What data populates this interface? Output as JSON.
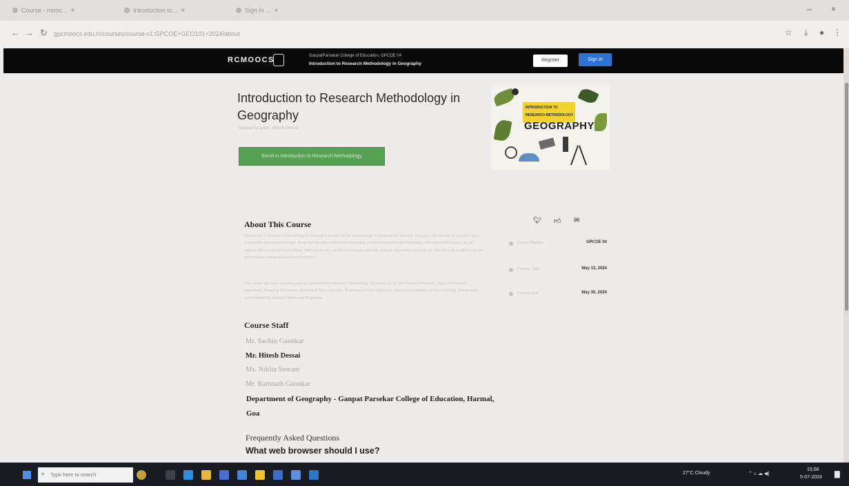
{
  "browser": {
    "tabs": [
      {
        "label": "Course - mooc..."
      },
      {
        "label": "Introduction to..."
      },
      {
        "label": "Sign in ..."
      }
    ],
    "url": "gpcmoocs.edu.in/courses/course-v1:GPCOE+GEO101+2024/about",
    "window_controls": {
      "minimize": "–",
      "close": "×"
    },
    "nav": {
      "back": "←",
      "forward": "→",
      "reload": "↻"
    }
  },
  "site": {
    "logo": "RCMOOCS",
    "course_code": "GanpatParsekar College of Education, GPCOE 04",
    "course_name": "Introduction to Research Methodology in Geography",
    "register_label": "Register",
    "signin_label": "Sign in"
  },
  "course": {
    "title": "Introduction to Research Methodology in Geography",
    "org": "GanpatParsekar · Hitesh Dessai",
    "enroll_label": "Enroll in Introduction to Research Methodology",
    "cover": {
      "line1": "INTRODUCTION TO",
      "line2": "RESEARCH METHODOLOGY",
      "word": "GEOGRAPHY"
    }
  },
  "about": {
    "title": "About This Course",
    "paragraph1": "Introduction to Research Methodology in Geography focuses on the methodology of geographical research. It explains the concept of research, types of research and research design, along with the steps involved in formulating a research problem and hypothesis. Throughout this course, we will explore different research paradigms, field techniques, sampling techniques and data analysis approaches to equip you with the tools needed to design and execute a geographical research project.",
    "paragraph2": "This course will cover concepts such as Introduction to Research Methodology, Research Design and Research Problem, Types of Research, Hypothesis, Sampling Techniques, Methods of Data Collection, Techniques of Data Collection, Steps and Guidelines of Report Writing, Bibliography and Referencing, Abstract Writing and Plagiarism."
  },
  "staff": {
    "title": "Course Staff",
    "members": [
      "Mr. Sachin Gaonkar",
      "Mr. Hitesh Dessai",
      "Ms. Nikita Sawant",
      "Mr. Ramnath Gaonkar"
    ],
    "department": "Department of Geography - Ganpat Parsekar College of Education, Harmal, Goa"
  },
  "faq": {
    "title": "Frequently Asked Questions",
    "first_question": "What web browser should I use?"
  },
  "sidebar": {
    "social": [
      "twitter-icon",
      "like-icon",
      "email-icon"
    ],
    "info": [
      {
        "label": "Course Number",
        "value": "GPCOE 04"
      },
      {
        "label": "Classes Start",
        "value": "May 13, 2024"
      },
      {
        "label": "Classes End",
        "value": "May 30, 2024"
      }
    ]
  },
  "taskbar": {
    "search_placeholder": "Type here to search",
    "weather": "27°C Cloudy",
    "time": "15:08",
    "date": "5-07-2024"
  }
}
